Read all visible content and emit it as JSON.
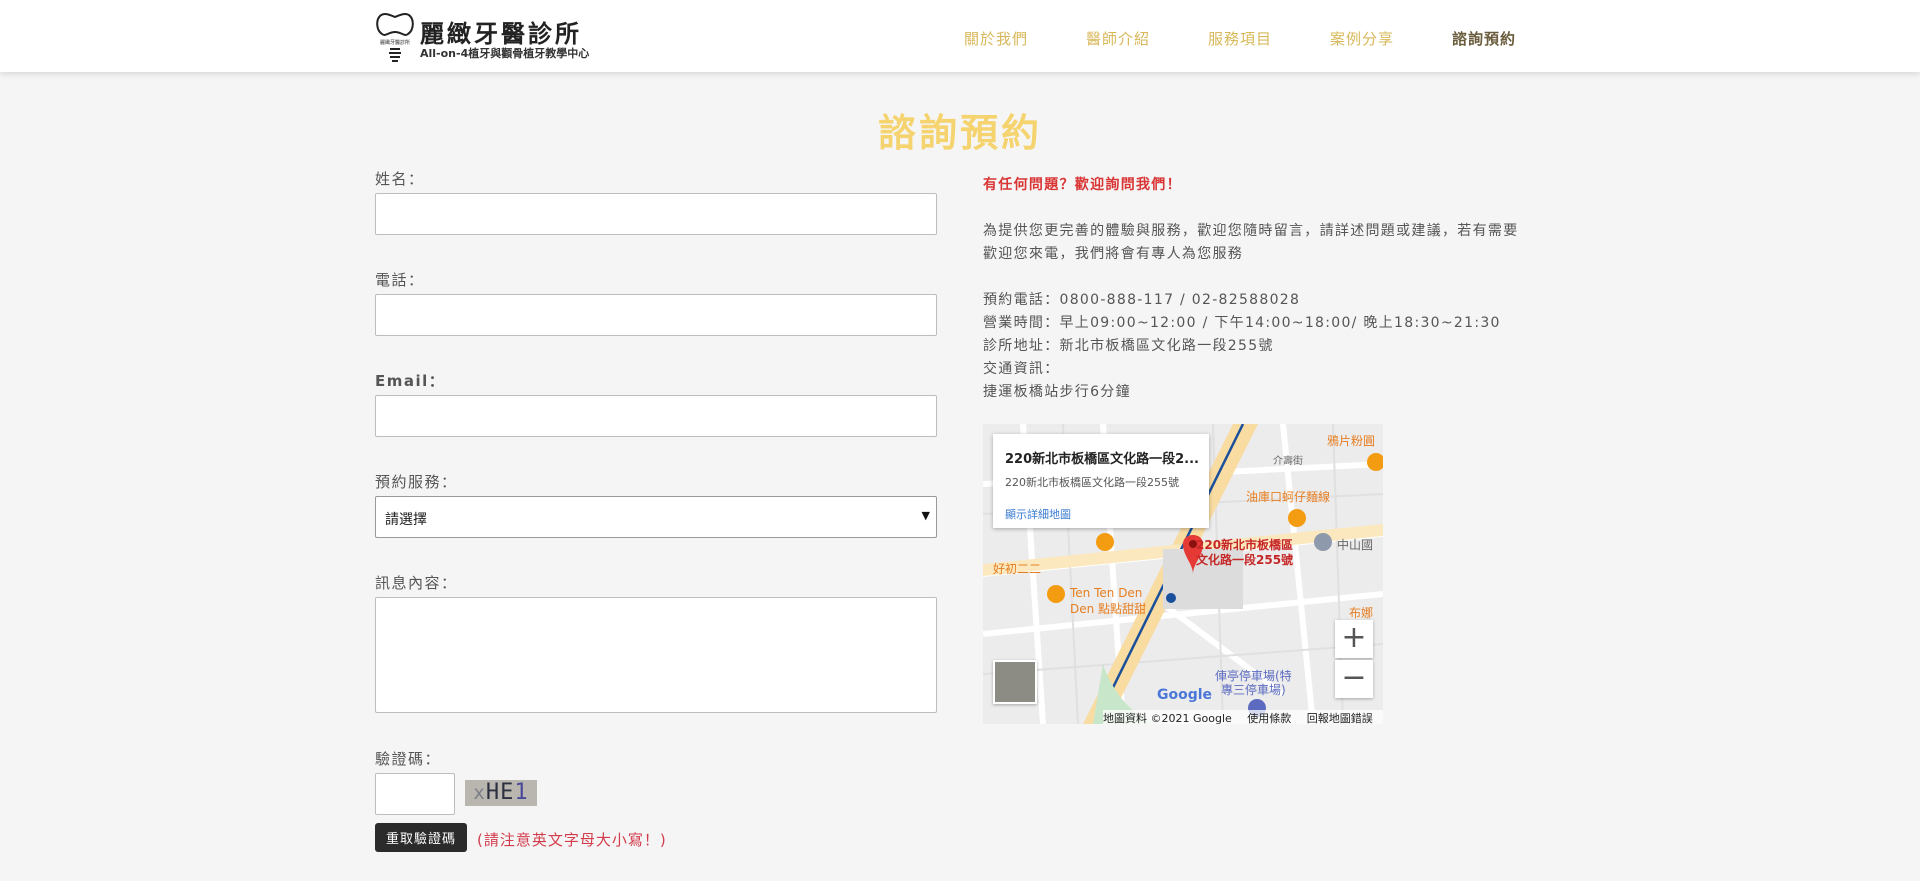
{
  "header": {
    "logo_title": "麗緻牙醫診所",
    "logo_subtitle": "All-on-4植牙與顴骨植牙教學中心",
    "nav": [
      {
        "label": "關於我們",
        "active": false
      },
      {
        "label": "醫師介紹",
        "active": false
      },
      {
        "label": "服務項目",
        "active": false
      },
      {
        "label": "案例分享",
        "active": false
      },
      {
        "label": "諮詢預約",
        "active": true
      }
    ]
  },
  "page_title": "諮詢預約",
  "form": {
    "name_label": "姓名：",
    "phone_label": "電話：",
    "email_label": "Email：",
    "service_label": "預約服務：",
    "service_selected": "請選擇",
    "message_label": "訊息內容：",
    "captcha_label": "驗證碼：",
    "captcha_chars": [
      "x",
      "H",
      "E",
      "1"
    ],
    "refresh_button": "重取驗證碼",
    "case_note": "(請注意英文字母大小寫！)"
  },
  "info": {
    "lead": "有任何問題？歡迎詢問我們！",
    "desc_line1": "為提供您更完善的體驗與服務，歡迎您隨時留言，請詳述問題或建議，若有需要",
    "desc_line2": "歡迎您來電，我們將會有專人為您服務",
    "phone": "預約電話：0800-888-117 / 02-82588028",
    "hours": "營業時間：早上09:00~12:00 / 下午14:00~18:00/ 晚上18:30~21:30",
    "address": "診所地址：新北市板橋區文化路一段255號",
    "transport_label": "交通資訊：",
    "transport_detail": "捷運板橋站步行6分鐘"
  },
  "map": {
    "card_title": "220新北市板橋區文化路一段2...",
    "card_address": "220新北市板橋區文化路一段255號",
    "card_link": "顯示詳細地圖",
    "pin_label_line1": "220新北市板橋區",
    "pin_label_line2": "文化路一段255號",
    "zoom_in": "+",
    "zoom_out": "−",
    "logo": "Google",
    "footer": [
      "地圖資料 ©2021 Google",
      "使用條款",
      "回報地圖錯誤"
    ],
    "places": {
      "p1": "鴉片粉圓",
      "p2": "油庫口蚵仔麵線",
      "p3": "中山國",
      "p4": "好初二二",
      "p5": "Ten Ten Den",
      "p6": "Den 點點甜甜",
      "p7": "布娜",
      "p8": "俥亭停車場(特",
      "p9": "專三停車場)",
      "street1": "介壽街"
    },
    "colors": {
      "road": "#f8dca2",
      "rail": "#1a4f9c",
      "pin": "#e53935",
      "food": "#f39c12"
    }
  }
}
